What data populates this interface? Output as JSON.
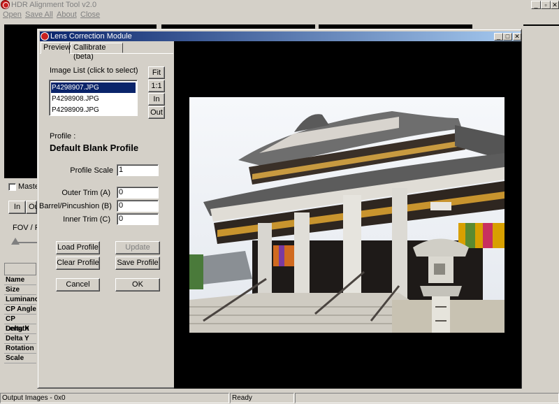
{
  "app": {
    "title": "HDR Alignment Tool  v2.0",
    "menu": [
      "Open",
      "Save All",
      "About",
      "Close"
    ],
    "win_buttons": [
      "_",
      "▫",
      "✕"
    ]
  },
  "main_left": {
    "master_label": "Maste",
    "in_label": "In",
    "out_label": "Ou",
    "fov_label": "FOV / FL",
    "rows": [
      "Name",
      "Size",
      "Luminanc",
      "CP Angle",
      "CP Length",
      "Delta X",
      "Delta Y",
      "Rotation",
      "Scale"
    ]
  },
  "status": {
    "output": "Output Images - 0x0",
    "state": "Ready"
  },
  "dialog": {
    "title": "Lens Correction Module",
    "buttons": [
      "_",
      "□",
      "✕"
    ],
    "tabs": [
      "Preview",
      "Callibrate (beta)"
    ],
    "image_list_label": "Image List  (click to select)",
    "images": [
      "P4298907.JPG",
      "P4298908.JPG",
      "P4298909.JPG"
    ],
    "selected_index": 0,
    "zoom_buttons": [
      "Fit",
      "1:1",
      "In",
      "Out"
    ],
    "profile_label": "Profile :",
    "profile_name": "Default Blank Profile",
    "profile_scale": {
      "label": "Profile Scale",
      "value": "1"
    },
    "outer_trim": {
      "label": "Outer Trim (A)",
      "value": "0"
    },
    "barrel": {
      "label": "Barrel/Pincushion (B)",
      "value": "0"
    },
    "inner_trim": {
      "label": "Inner Trim (C)",
      "value": "0"
    },
    "actions": {
      "load": "Load Profile",
      "update": "Update",
      "clear": "Clear Profile",
      "save": "Save Profile",
      "cancel": "Cancel",
      "ok": "OK"
    }
  }
}
